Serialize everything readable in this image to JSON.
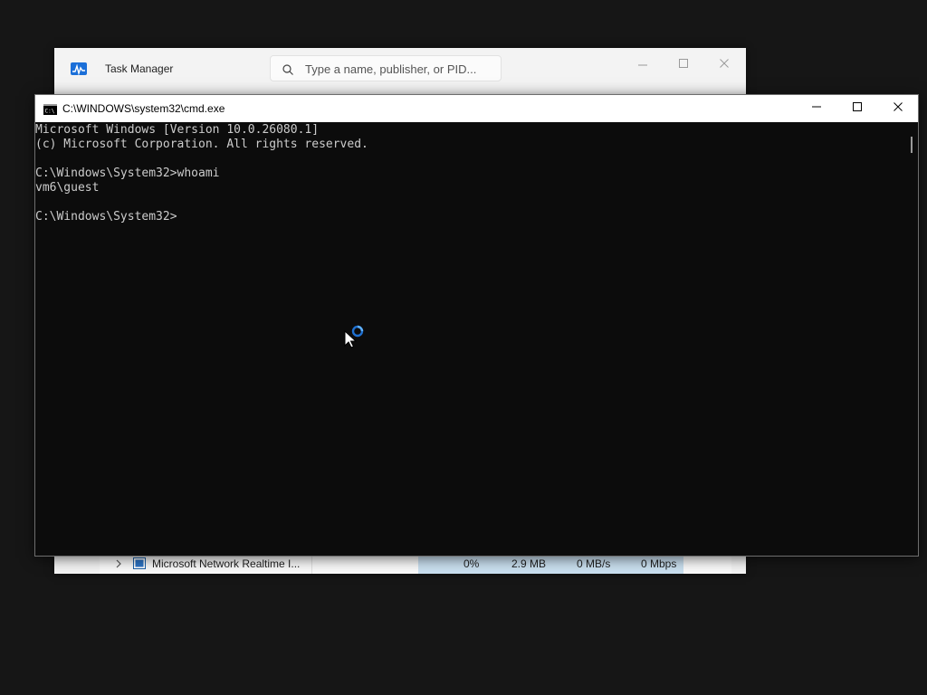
{
  "task_manager": {
    "title": "Task Manager",
    "search_placeholder": "Type a name, publisher, or PID...",
    "visible_process": {
      "name": "Microsoft Network Realtime I...",
      "cpu": "0%",
      "memory": "2.9 MB",
      "disk": "0 MB/s",
      "network": "0 Mbps"
    }
  },
  "cmd": {
    "title": "C:\\WINDOWS\\system32\\cmd.exe",
    "lines": [
      "Microsoft Windows [Version 10.0.26080.1]",
      "(c) Microsoft Corporation. All rights reserved.",
      "",
      "C:\\Windows\\System32>whoami",
      "vm6\\guest",
      "",
      "C:\\Windows\\System32>"
    ]
  },
  "icons": {
    "task_manager_app": "task-manager-icon",
    "search": "search-icon",
    "cmd_app": "cmd-icon",
    "minimize": "minimize-icon",
    "maximize": "maximize-icon",
    "close": "close-icon",
    "expand": "chevron-right-icon",
    "process": "process-icon",
    "cursor": "busy-cursor-icon"
  },
  "colors": {
    "console_background": "#0c0c0c",
    "console_text": "#cccccc",
    "busy_ring": "#2f8be6"
  }
}
